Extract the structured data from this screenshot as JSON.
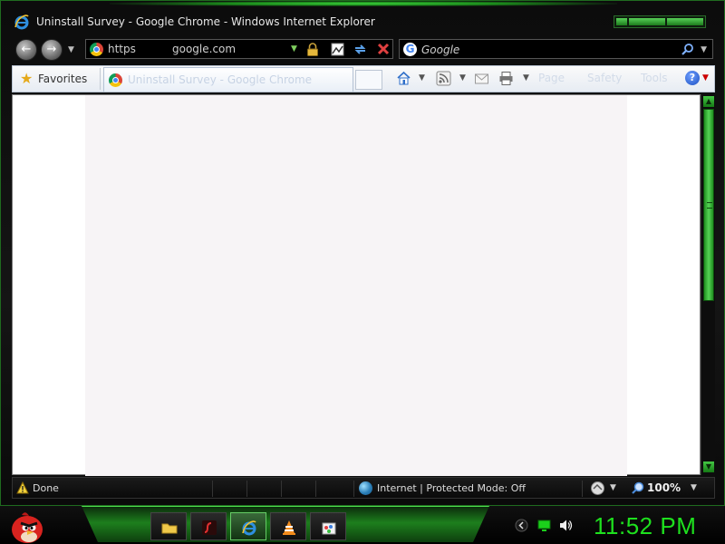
{
  "window": {
    "title": "Uninstall Survey - Google Chrome - Windows Internet Explorer"
  },
  "address_bar": {
    "scheme": "https",
    "host": "google.com"
  },
  "search": {
    "placeholder": "Google"
  },
  "command_bar": {
    "favorites_label": "Favorites",
    "tab_title": "Uninstall Survey - Google Chrome",
    "page_label": "Page",
    "safety_label": "Safety",
    "tools_label": "Tools"
  },
  "status_bar": {
    "status": "Done",
    "zone": "Internet | Protected Mode: Off",
    "zoom": "100%"
  },
  "taskbar": {
    "clock": "11:52 PM",
    "items": [
      "folder-icon",
      "flash-player-icon",
      "internet-explorer-icon",
      "vlc-icon",
      "paint-icon"
    ]
  },
  "colors": {
    "accent": "#1ee01e",
    "page_background": "#f7f4f6"
  }
}
